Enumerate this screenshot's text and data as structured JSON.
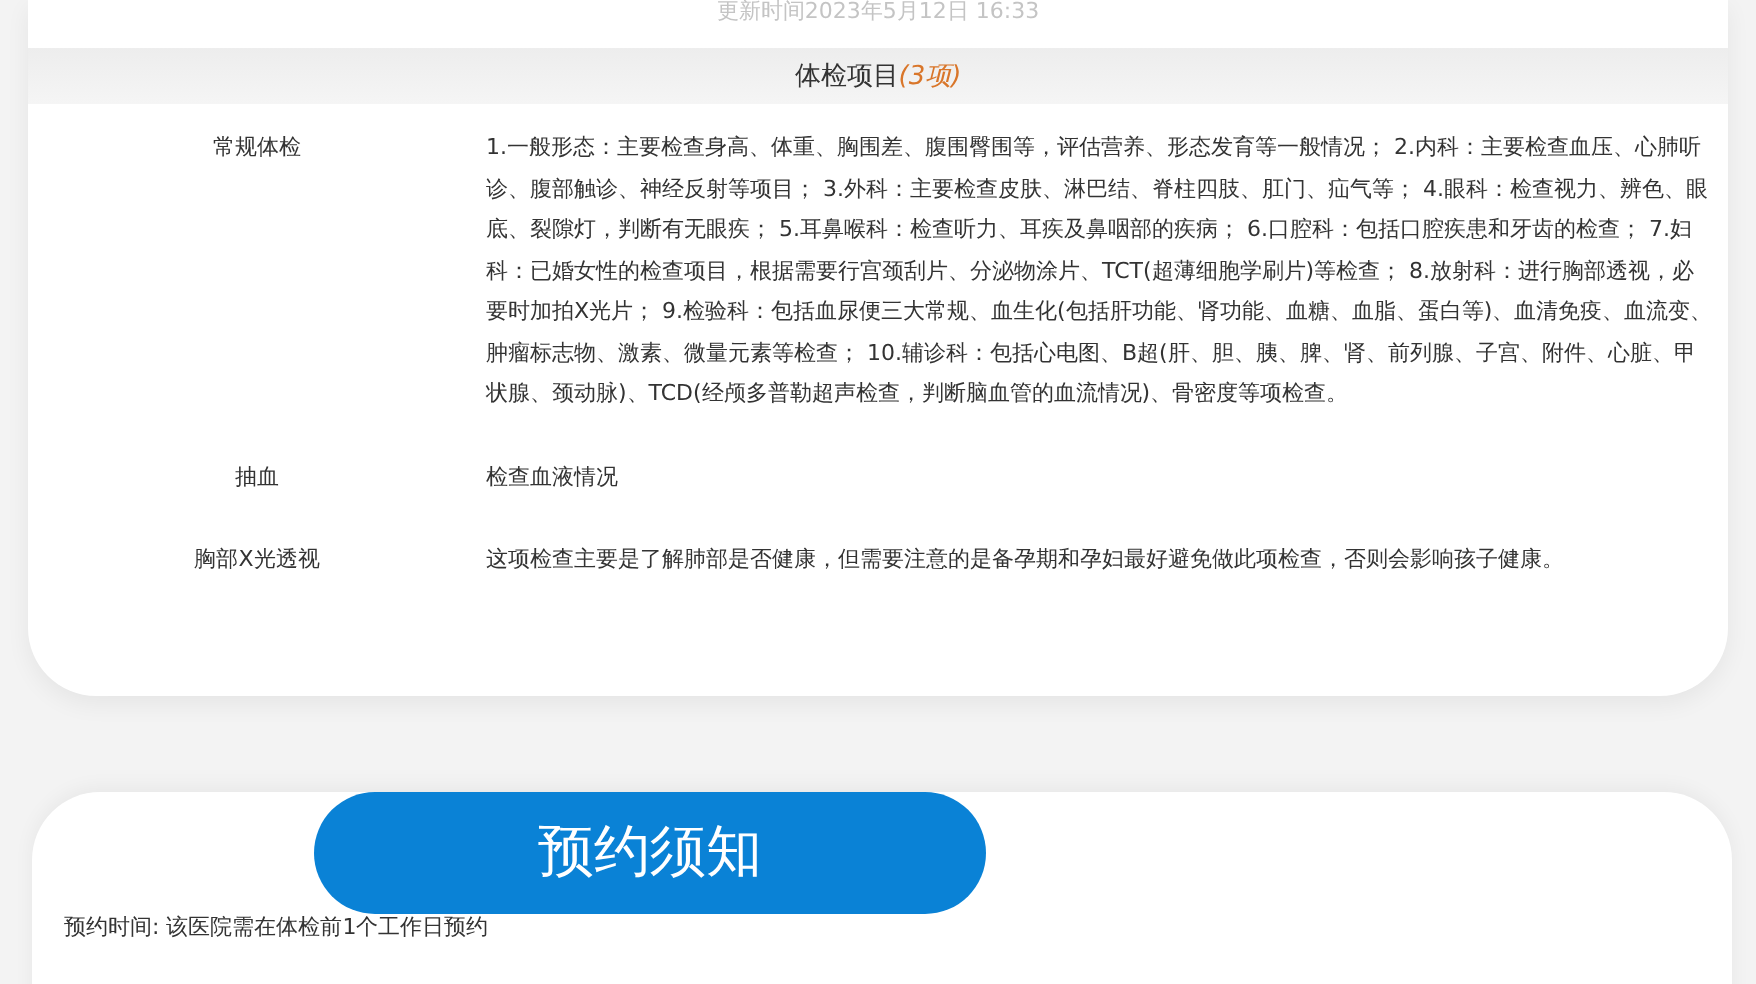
{
  "update_time": "更新时间2023年5月12日 16:33",
  "section": {
    "title": "体检项目",
    "count": "(3项)"
  },
  "items": [
    {
      "name": "常规体检",
      "description": "1.一般形态：主要检查身高、体重、胸围差、腹围臀围等，评估营养、形态发育等一般情况； 2.内科：主要检查血压、心肺听诊、腹部触诊、神经反射等项目； 3.外科：主要检查皮肤、淋巴结、脊柱四肢、肛门、疝气等； 4.眼科：检查视力、辨色、眼底、裂隙灯，判断有无眼疾； 5.耳鼻喉科：检查听力、耳疾及鼻咽部的疾病； 6.口腔科：包括口腔疾患和牙齿的检查； 7.妇科：已婚女性的检查项目，根据需要行宫颈刮片、分泌物涂片、TCT(超薄细胞学刷片)等检查； 8.放射科：进行胸部透视，必要时加拍X光片； 9.检验科：包括血尿便三大常规、血生化(包括肝功能、肾功能、血糖、血脂、蛋白等)、血清免疫、血流变、肿瘤标志物、激素、微量元素等检查； 10.辅诊科：包括心电图、B超(肝、胆、胰、脾、肾、前列腺、子宫、附件、心脏、甲状腺、颈动脉)、TCD(经颅多普勒超声检查，判断脑血管的血流情况)、骨密度等项检查。"
    },
    {
      "name": "抽血",
      "description": "检查血液情况"
    },
    {
      "name": "胸部X光透视",
      "description": "这项检查主要是了解肺部是否健康，但需要注意的是备孕期和孕妇最好避免做此项检查，否则会影响孩子健康。"
    }
  ],
  "notice": {
    "heading": "预约须知",
    "text": "预约时间: 该医院需在体检前1个工作日预约"
  }
}
